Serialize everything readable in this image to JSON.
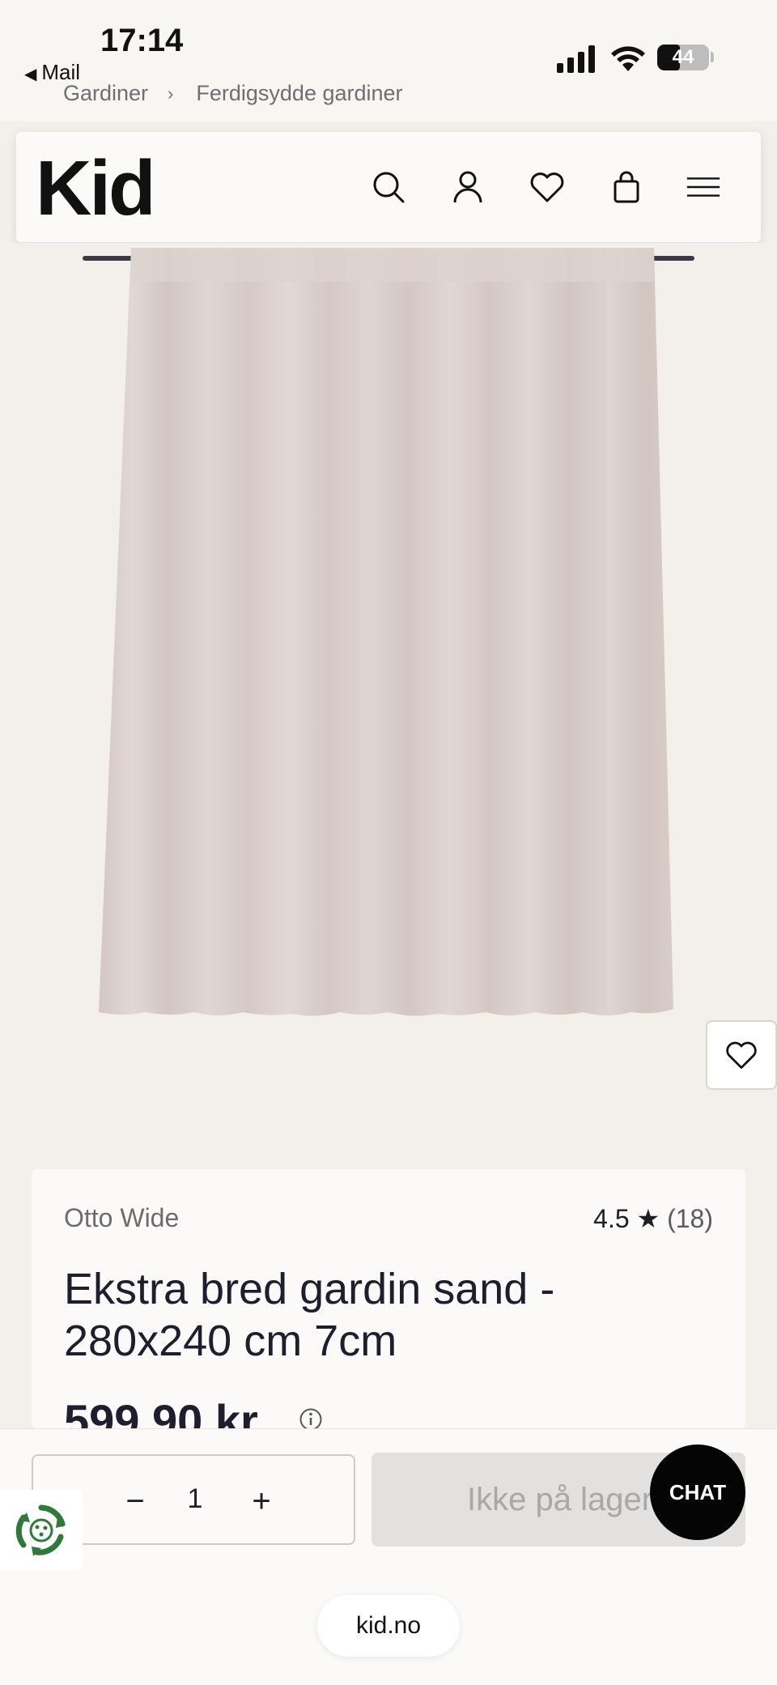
{
  "status_bar": {
    "time": "17:14",
    "back_label": "Mail",
    "battery_percent": "44",
    "battery_level": 0.44
  },
  "breadcrumb": {
    "items": [
      "Gardiner",
      "Ferdigsydde gardiner"
    ],
    "separator": "›"
  },
  "header": {
    "logo": "Kid",
    "icons": [
      "search-icon",
      "account-icon",
      "wishlist-icon",
      "cart-icon",
      "menu-icon"
    ]
  },
  "product": {
    "brand": "Otto Wide",
    "rating": "4.5",
    "rating_star": "★",
    "review_count": "(18)",
    "title": "Ekstra bred gardin sand - 280x240 cm 7cm",
    "price": "599,90 kr",
    "image_color": "#d8cdc8"
  },
  "purchase": {
    "quantity": "1",
    "minus_label": "−",
    "plus_label": "+",
    "button_label": "Ikke på lager",
    "chat_label": "CHAT"
  },
  "browser": {
    "url": "kid.no"
  },
  "colors": {
    "background": "#f3f0eb",
    "card": "#fbfaf8",
    "text": "#1e1e2e",
    "disabled_button": "#e2e1df",
    "chat": "#050505",
    "eco_green": "#2f7a3a"
  }
}
